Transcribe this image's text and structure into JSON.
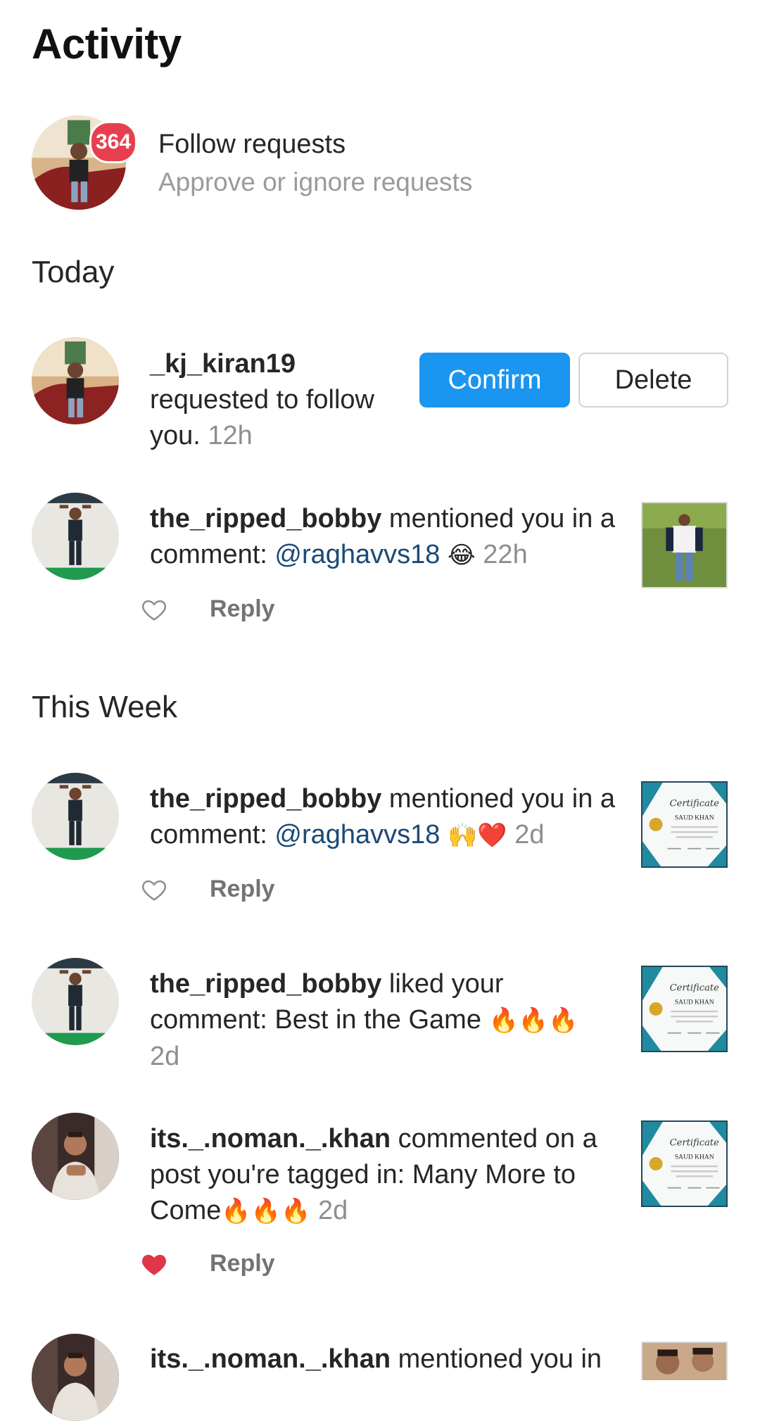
{
  "header": {
    "title": "Activity"
  },
  "follow_requests": {
    "badge_count": "364",
    "title": "Follow requests",
    "subtitle": "Approve or ignore requests"
  },
  "sections": {
    "today": "Today",
    "this_week": "This Week"
  },
  "today": {
    "request": {
      "username": "_kj_kiran19",
      "text_line1": "requested to follow",
      "text_line2": "you.",
      "time": "12h",
      "confirm_label": "Confirm",
      "delete_label": "Delete"
    },
    "mention": {
      "username": "the_ripped_bobby",
      "action": " mentioned you in a",
      "prefix": "comment: ",
      "mention": "@raghavvs18",
      "emoji": "😂",
      "time": "22h",
      "reply_label": "Reply",
      "liked": false
    }
  },
  "this_week": {
    "mention": {
      "username": "the_ripped_bobby",
      "action": " mentioned you in a",
      "prefix": "comment: ",
      "mention": "@raghavvs18",
      "emoji": "🙌❤️",
      "time": "2d",
      "reply_label": "Reply",
      "liked": false
    },
    "like": {
      "username": "the_ripped_bobby",
      "action": " liked your",
      "text": "comment: Best in the Game ",
      "emoji": "🔥🔥🔥",
      "time": "2d"
    },
    "comment": {
      "username": "its._.noman._.khan",
      "action": " commented on a",
      "text_line2": "post you're tagged in: Many More to",
      "text_line3": "Come",
      "emoji": "🔥🔥🔥",
      "time": "2d",
      "reply_label": "Reply",
      "liked": true
    },
    "mention2": {
      "username": "its._.noman._.khan",
      "action": " mentioned you in"
    }
  },
  "certificate": {
    "heading": "Certificate",
    "name": "SAUD KHAN"
  },
  "icons": {
    "like": "heart-icon",
    "liked": "heart-filled-icon"
  },
  "colors": {
    "accent": "#1a95f0",
    "badge": "#e83f4f",
    "heart_liked": "#e0364a",
    "mention": "#1b4a76"
  }
}
